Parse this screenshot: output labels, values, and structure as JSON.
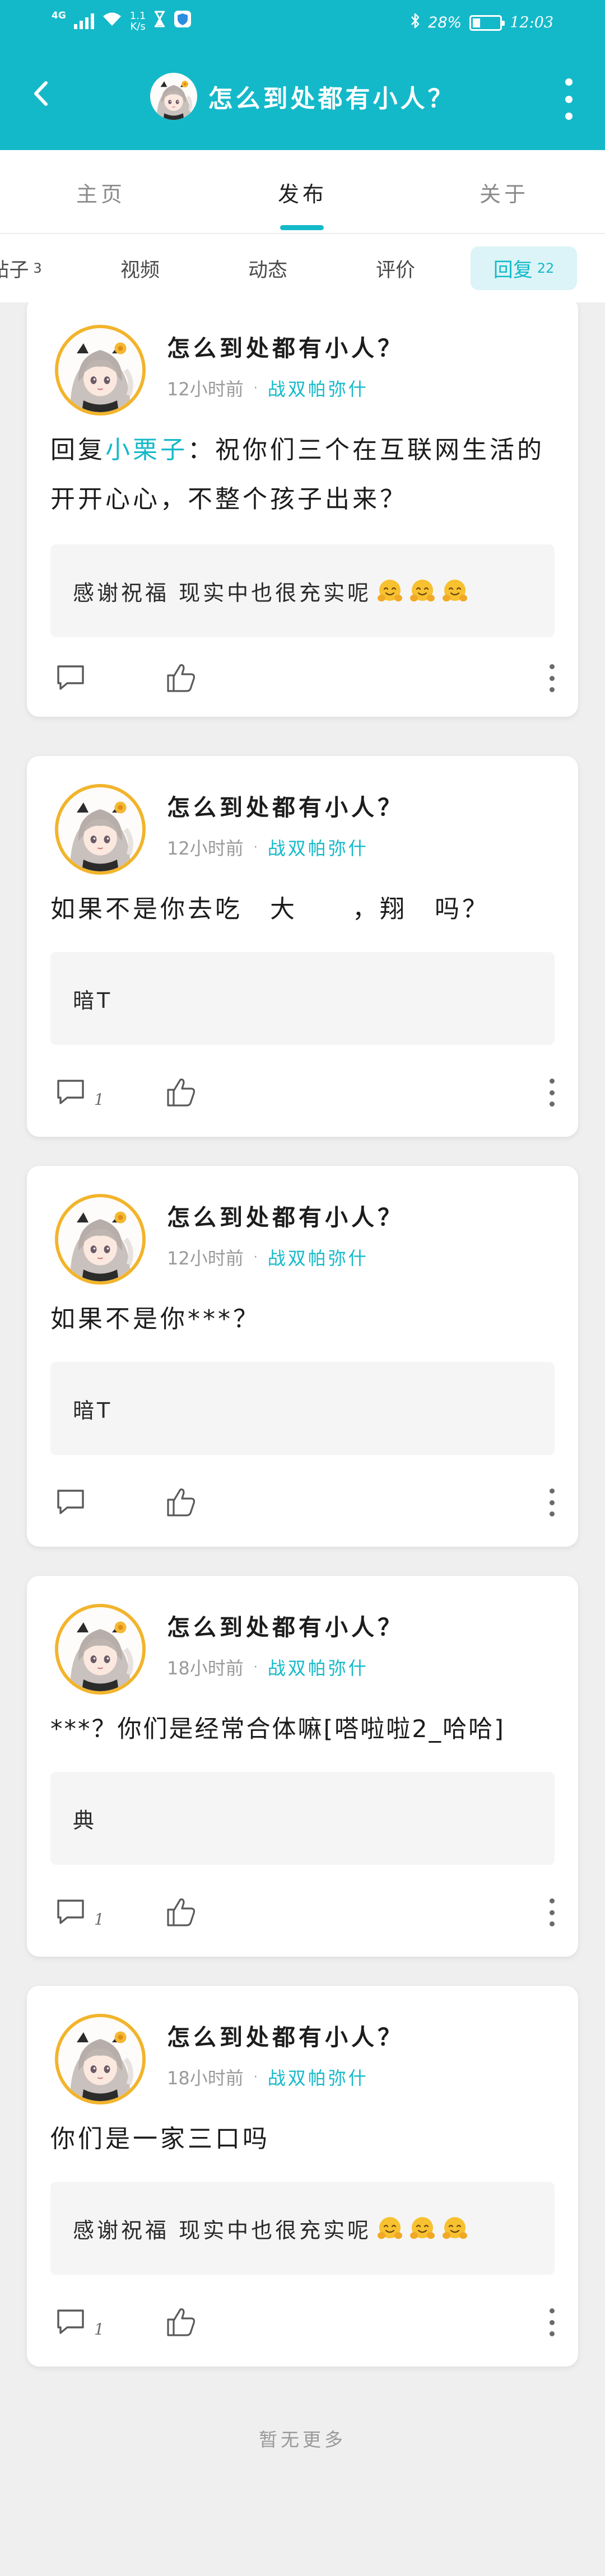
{
  "status_bar": {
    "signal_label": "4G",
    "net_speed_value": "1.1",
    "net_speed_unit": "K/s",
    "battery": "28%",
    "battery_level": 0.28,
    "time": "12:03"
  },
  "header": {
    "title": "怎么到处都有小人？",
    "background": "#14b9c9",
    "icons": [
      "back-arrow-icon",
      "more-vertical-icon"
    ]
  },
  "main_tabs": [
    {
      "label": "主页"
    },
    {
      "label": "发布",
      "active": true
    },
    {
      "label": "关于"
    }
  ],
  "sub_tabs": [
    {
      "label": "帖子",
      "count": "3"
    },
    {
      "label": "视频",
      "count": ""
    },
    {
      "label": "动态",
      "count": ""
    },
    {
      "label": "评价",
      "count": ""
    },
    {
      "label": "回复",
      "count": "22",
      "active": true
    }
  ],
  "posts": [
    {
      "author": "怎么到处都有小人？",
      "time": "12小时前",
      "separator": "·",
      "tag": "战双帕弥什",
      "content_prefix": "回复",
      "mention": "小栗子",
      "content": "：祝你们三个在互联网生活的开开心心，不整个孩子出来？",
      "quote": "感谢祝福 现实中也很充实呢",
      "quote_emoji_count": 3,
      "comments": ""
    },
    {
      "author": "怎么到处都有小人？",
      "time": "12小时前",
      "separator": "·",
      "tag": "战双帕弥什",
      "content": "如果不是你去吃　大　　，翔　吗？",
      "quote": "暗T",
      "comments": "1"
    },
    {
      "author": "怎么到处都有小人？",
      "time": "12小时前",
      "separator": "·",
      "tag": "战双帕弥什",
      "content": "如果不是你***？",
      "quote": "暗T",
      "comments": ""
    },
    {
      "author": "怎么到处都有小人？",
      "time": "18小时前",
      "separator": "·",
      "tag": "战双帕弥什",
      "content": "***？你们是经常合体嘛[嗒啦啦2_哈哈]",
      "quote": "典",
      "comments": "1"
    },
    {
      "author": "怎么到处都有小人？",
      "time": "18小时前",
      "separator": "·",
      "tag": "战双帕弥什",
      "content": "你们是一家三口吗",
      "quote": "感谢祝福 现实中也很充实呢",
      "quote_emoji_count": 3,
      "comments": "1"
    }
  ],
  "footer": {
    "no_more": "暂无更多"
  }
}
